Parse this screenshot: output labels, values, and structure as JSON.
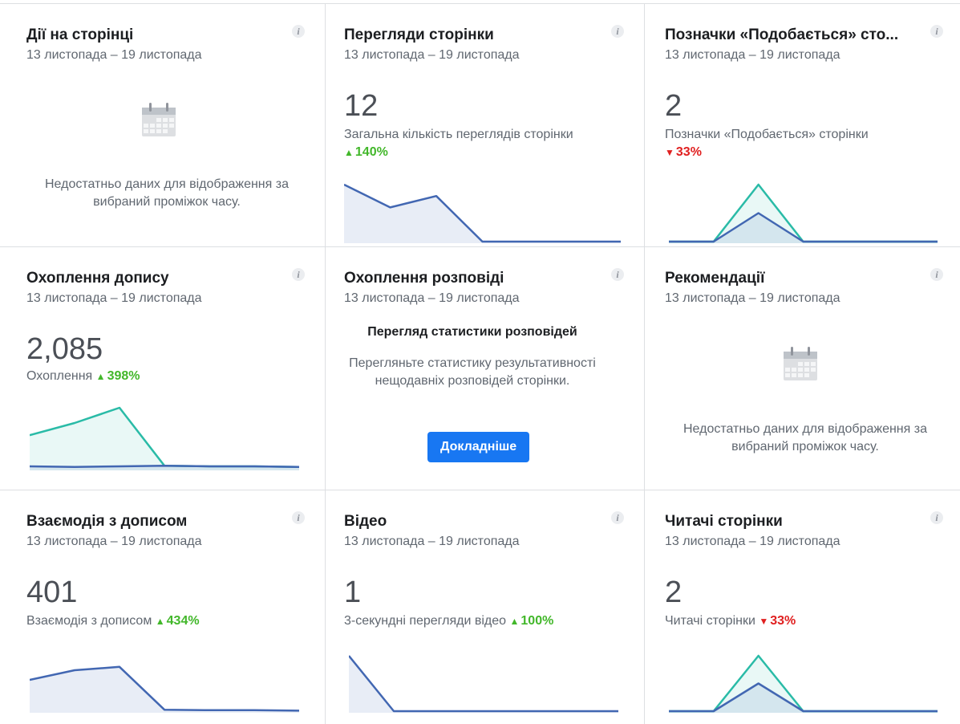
{
  "cards": [
    {
      "title": "Дії на сторінці",
      "date": "13 листопада – 19 листопада",
      "info_icon": "i",
      "no_data": "Недостатньо даних для відображення за вибраний проміжок часу."
    },
    {
      "title": "Перегляди сторінки",
      "date": "13 листопада – 19 листопада",
      "info_icon": "i",
      "value": "12",
      "label": "Загальна кількість переглядів сторінки",
      "change": "140%",
      "change_dir": "up",
      "chart_data": {
        "type": "area",
        "series": [
          {
            "values": [
              100,
              60,
              80,
              0,
              0,
              0,
              0
            ],
            "color": "#4267b2"
          }
        ],
        "ylim": [
          0,
          100
        ]
      }
    },
    {
      "title": "Позначки «Подобається» сто...",
      "date": "13 листопада – 19 листопада",
      "info_icon": "i",
      "value": "2",
      "label": "Позначки «Подобається» сторінки",
      "change": "33%",
      "change_dir": "down",
      "chart_data": {
        "type": "area",
        "series": [
          {
            "values": [
              0,
              0,
              100,
              0,
              0,
              0,
              0
            ],
            "color": "#2abba7"
          },
          {
            "values": [
              0,
              0,
              50,
              0,
              0,
              0,
              0
            ],
            "color": "#4267b2"
          }
        ],
        "ylim": [
          0,
          100
        ]
      }
    },
    {
      "title": "Охоплення допису",
      "date": "13 листопада – 19 листопада",
      "info_icon": "i",
      "value": "2,085",
      "label": "Охоплення",
      "change": "398%",
      "change_dir": "up",
      "chart_data": {
        "type": "area",
        "series": [
          {
            "values": [
              55,
              75,
              100,
              5,
              4,
              4,
              3
            ],
            "color": "#2abba7"
          },
          {
            "values": [
              4,
              3,
              4,
              5,
              4,
              4,
              3
            ],
            "color": "#4267b2"
          }
        ],
        "ylim": [
          0,
          100
        ]
      }
    },
    {
      "title": "Охоплення розповіді",
      "date": "13 листопада – 19 листопада",
      "info_icon": "i",
      "promo_title": "Перегляд статистики розповідей",
      "promo_text": "Перегляньте статистику результативності нещодавніх розповідей сторінки.",
      "button": "Докладніше"
    },
    {
      "title": "Рекомендації",
      "date": "13 листопада – 19 листопада",
      "info_icon": "i",
      "no_data": "Недостатньо даних для відображення за вибраний проміжок часу."
    },
    {
      "title": "Взаємодія з дописом",
      "date": "13 листопада – 19 листопада",
      "info_icon": "i",
      "value": "401",
      "label": "Взаємодія з дописом",
      "change": "434%",
      "change_dir": "up",
      "chart_data": {
        "type": "area",
        "series": [
          {
            "values": [
              65,
              85,
              92,
              3,
              2,
              2,
              1
            ],
            "color": "#4267b2"
          }
        ],
        "ylim": [
          0,
          100
        ]
      }
    },
    {
      "title": "Відео",
      "date": "13 листопада – 19 листопада",
      "info_icon": "i",
      "value": "1",
      "label": "3-секундні перегляди відео",
      "change": "100%",
      "change_dir": "up",
      "chart_data": {
        "type": "area",
        "series": [
          {
            "values": [
              100,
              0,
              0,
              0,
              0,
              0,
              0
            ],
            "color": "#4267b2"
          }
        ],
        "ylim": [
          0,
          100
        ]
      }
    },
    {
      "title": "Читачі сторінки",
      "date": "13 листопада – 19 листопада",
      "info_icon": "i",
      "value": "2",
      "label": "Читачі сторінки",
      "change": "33%",
      "change_dir": "down",
      "chart_data": {
        "type": "area",
        "series": [
          {
            "values": [
              0,
              0,
              100,
              0,
              0,
              0,
              0
            ],
            "color": "#2abba7"
          },
          {
            "values": [
              0,
              0,
              50,
              0,
              0,
              0,
              0
            ],
            "color": "#4267b2"
          }
        ],
        "ylim": [
          0,
          100
        ]
      }
    }
  ]
}
